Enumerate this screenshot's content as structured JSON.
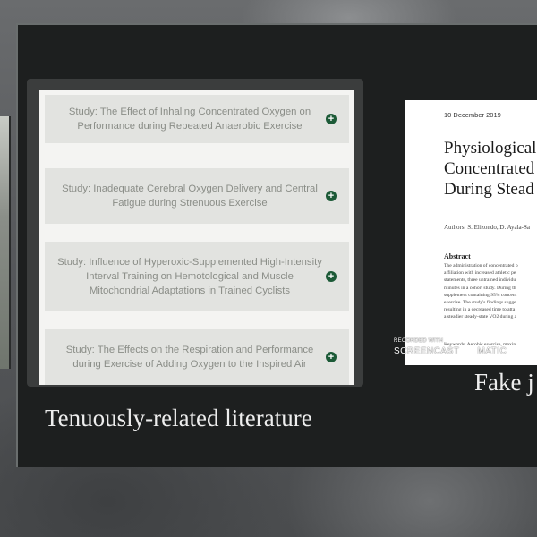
{
  "studies": [
    "Study: The Effect of Inhaling Concentrated Oxygen on Performance during Repeated Anaerobic Exercise",
    "Study: Inadequate Cerebral Oxygen Delivery and Central Fatigue during Strenuous Exercise",
    "Study: Influence of Hyperoxic-Supplemented High-Intensity Interval Training on Hemotological and Muscle Mitochondrial Adaptations in Trained Cyclists",
    "Study: The Effects on the Respiration and Performance during Exercise of Adding Oxygen to the Inspired Air"
  ],
  "captions": {
    "left": "Tenuously-related literature",
    "right": "Fake j"
  },
  "journal": {
    "date": "10 December 2019",
    "title_lines": [
      "Physiological",
      "Concentrated",
      "During Stead"
    ],
    "authors": "Authors: S. Elizondo, D. Ayala-Sa",
    "abstract_heading": "Abstract",
    "abstract_lines": [
      "The administration of concentrated o",
      "affiliation with increased athletic pe",
      "statements, three untrained individu",
      "minutes in a cohort study. During th",
      "supplement containing 95% concent",
      "exercise. The study's findings sugge",
      "resulting in a decreased time to atta",
      "a steadier steady-state VO2 during a"
    ],
    "keywords": "Keywords: Aerobic exercise, maxin"
  },
  "watermark": {
    "small": "Recorded with",
    "brand_left": "SCREENCAST",
    "brand_right": "MATIC"
  },
  "colors": {
    "plus_icon": "#1c5a37",
    "slide_bg": "#1d1f1f"
  }
}
